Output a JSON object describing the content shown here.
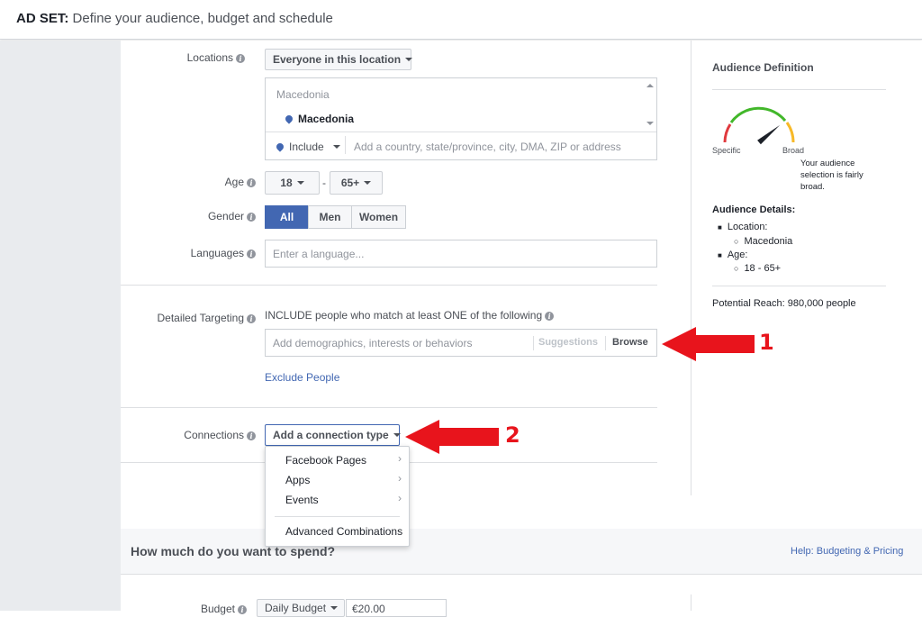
{
  "header": {
    "prefix": "AD SET:",
    "subtitle": "Define your audience, budget and schedule"
  },
  "locations": {
    "label": "Locations",
    "scope_button": "Everyone in this location",
    "group_title": "Macedonia",
    "selected": "Macedonia",
    "include_label": "Include",
    "input_placeholder": "Add a country, state/province, city, DMA, ZIP or address"
  },
  "age": {
    "label": "Age",
    "min": "18",
    "separator": "-",
    "max": "65+"
  },
  "gender": {
    "label": "Gender",
    "options": [
      "All",
      "Men",
      "Women"
    ],
    "selected": "All"
  },
  "languages": {
    "label": "Languages",
    "placeholder": "Enter a language..."
  },
  "detailed_targeting": {
    "label": "Detailed Targeting",
    "description": "INCLUDE people who match at least ONE of the following",
    "placeholder": "Add demographics, interests or behaviors",
    "suggestions": "Suggestions",
    "browse": "Browse",
    "exclude": "Exclude People"
  },
  "connections": {
    "label": "Connections",
    "button": "Add a connection type",
    "menu": [
      "Facebook Pages",
      "Apps",
      "Events",
      "Advanced Combinations"
    ]
  },
  "audience": {
    "title": "Audience Definition",
    "gauge_specific": "Specific",
    "gauge_broad": "Broad",
    "gauge_level": 0.78,
    "gauge_text_1": "Your audience",
    "gauge_text_2": "selection is fairly",
    "gauge_text_3": "broad.",
    "details_title": "Audience Details:",
    "location_label": "Location:",
    "location_value": "Macedonia",
    "age_label": "Age:",
    "age_value": "18 - 65+",
    "reach": "Potential Reach: 980,000 people"
  },
  "spend": {
    "title": "How much do you want to spend?",
    "help_link": "Help: Budgeting & Pricing",
    "budget_label": "Budget",
    "budget_type": "Daily Budget",
    "budget_value": "€20.00"
  },
  "annotations": {
    "arrow_1": "1",
    "arrow_2": "2",
    "color": "#e8141c"
  }
}
